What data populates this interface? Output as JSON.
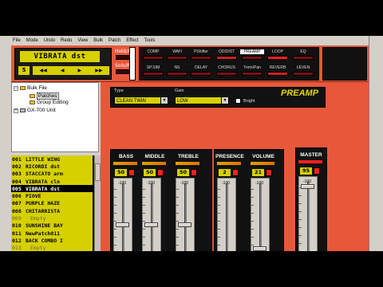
{
  "menu": [
    "File",
    "Mode",
    "Undo",
    "Redo",
    "View",
    "Bulk",
    "Patch",
    "Effect",
    "Tools"
  ],
  "patch": {
    "name": "VIBRATA dst",
    "number": "5",
    "hold_label": "Hold/Arc",
    "solo_label": "Solo/Rhy"
  },
  "effects": {
    "row1": [
      "COMP",
      "WAH",
      "PShifter",
      "ODIDIST",
      "PREAMP",
      "LOOP",
      "EQ"
    ],
    "row2": [
      "SP.SIM",
      "NS",
      "DELAY",
      "CHORUS",
      "Trem/Pan",
      "REVERB",
      "LEVEN"
    ],
    "row1_states": [
      "off",
      "off",
      "off",
      "dim",
      "white",
      "on",
      "off"
    ],
    "row2_states": [
      "off",
      "off",
      "off",
      "off",
      "off",
      "dim",
      "off"
    ]
  },
  "tree": {
    "root": "Bulk File",
    "child1": "Patches",
    "child2": "Group Editing",
    "device": "GX-700 Unit",
    "minus": "−",
    "plus": "+"
  },
  "patch_list": [
    {
      "num": "001",
      "name": "LITTLE WING",
      "state": "normal"
    },
    {
      "num": "002",
      "name": "RICORDI dst",
      "state": "normal"
    },
    {
      "num": "003",
      "name": "STACCATO arm",
      "state": "normal"
    },
    {
      "num": "004",
      "name": "VIBRATA cln",
      "state": "normal"
    },
    {
      "num": "005",
      "name": "VIBRATA dst",
      "state": "sel"
    },
    {
      "num": "006",
      "name": "PIOVE",
      "state": "normal"
    },
    {
      "num": "007",
      "name": "PURPLE HAZE",
      "state": "normal"
    },
    {
      "num": "008",
      "name": "CHITARRISTA",
      "state": "normal"
    },
    {
      "num": "009",
      "name": "Empty",
      "state": "empty"
    },
    {
      "num": "010",
      "name": "SUNSHINE BAY",
      "state": "normal"
    },
    {
      "num": "011",
      "name": "NewPatch011",
      "state": "normal"
    },
    {
      "num": "012",
      "name": "BACK COMBO I",
      "state": "normal"
    },
    {
      "num": "013",
      "name": "Empty",
      "state": "empty"
    }
  ],
  "amp": {
    "type_label": "Type",
    "type_value": "CLEAN TWIN",
    "gain_label": "Gain",
    "gain_value": "LOW",
    "bright_label": "Bright",
    "title": "PREAMP"
  },
  "controls": [
    {
      "label": "BASS",
      "value": "50",
      "scale_top": "-100",
      "scale_bottom": "0",
      "level": 0.5
    },
    {
      "label": "MIDDLE",
      "value": "50",
      "scale_top": "-100",
      "scale_bottom": "0",
      "level": 0.5
    },
    {
      "label": "TREBLE",
      "value": "50",
      "scale_top": "-100",
      "scale_bottom": "0",
      "level": 0.5
    },
    {
      "label": "PRESENCE",
      "value": "2",
      "scale_top": "-100",
      "scale_bottom": "0",
      "level": 0.02
    },
    {
      "label": "VOLUME",
      "value": "21",
      "scale_top": "-100",
      "scale_bottom": "0",
      "level": 0.21
    },
    {
      "label": "MASTER",
      "value": "95",
      "scale_top": "-100",
      "scale_bottom": "0",
      "level": 0.95
    }
  ],
  "colors": {
    "accent": "#e8573a",
    "yellow": "#d6d000",
    "led_on": "#ff2020"
  }
}
